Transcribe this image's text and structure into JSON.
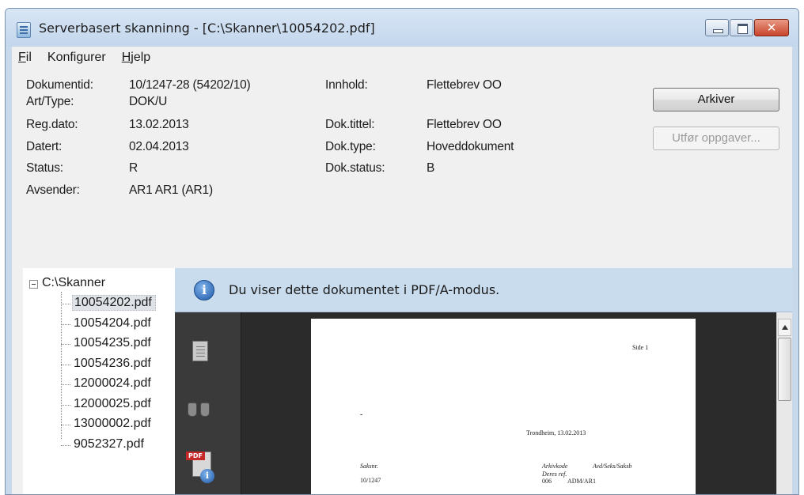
{
  "window": {
    "title": "Serverbasert skanninng - [C:\\Skanner\\10054202.pdf]",
    "close_glyph": "✕"
  },
  "menu": {
    "fil_first": "F",
    "fil_rest": "il",
    "konfigurer": "Konfigurer",
    "hjelp_first": "H",
    "hjelp_rest": "jelp"
  },
  "meta": {
    "dokumentid_label": "Dokumentid:",
    "dokumentid_value": "10/1247-28  (54202/10)",
    "arttype_label": "Art/Type:",
    "arttype_value": "DOK/U",
    "regdato_label": "Reg.dato:",
    "regdato_value": "13.02.2013",
    "datert_label": "Datert:",
    "datert_value": "02.04.2013",
    "status_label": "Status:",
    "status_value": "R",
    "avsender_label": "Avsender:",
    "avsender_value": "AR1 AR1 (AR1)",
    "innhold_label": "Innhold:",
    "innhold_value": "Flettebrev OO",
    "doktittel_label": "Dok.tittel:",
    "doktittel_value": "Flettebrev OO",
    "doktype_label": "Dok.type:",
    "doktype_value": "Hoveddokument",
    "dokstatus_label": "Dok.status:",
    "dokstatus_value": "B"
  },
  "buttons": {
    "arkiver": "Arkiver",
    "utfor": "Utfør oppgaver..."
  },
  "tree": {
    "root": "C:\\Skanner",
    "files": [
      "10054202.pdf",
      "10054204.pdf",
      "10054235.pdf",
      "10054236.pdf",
      "12000024.pdf",
      "12000025.pdf",
      "13000002.pdf",
      "9052327.pdf"
    ],
    "selected_index": 0
  },
  "viewer": {
    "info_glyph": "i",
    "info_text": "Du viser dette dokumentet i PDF/A-modus.",
    "pdf_tag": "PDF",
    "page": {
      "side": "Side 1",
      "dash": "-",
      "place_date": "Trondheim, 13.02.2013",
      "saksnr_label": "Saksnr.",
      "saksnr_value": "10/1247",
      "arkivkode_label": "Arkivkode",
      "avdseksaksb_label": "Avd/Seks/Saksb",
      "deres_ref_label": "Deres ref.",
      "arkivkode_value": "006",
      "avd_value": "ADM/AR1"
    }
  },
  "colors": {
    "info_bar": "#c9dced",
    "viewer_bg": "#2b2b2b",
    "window_frame": "#c9d9ec"
  }
}
